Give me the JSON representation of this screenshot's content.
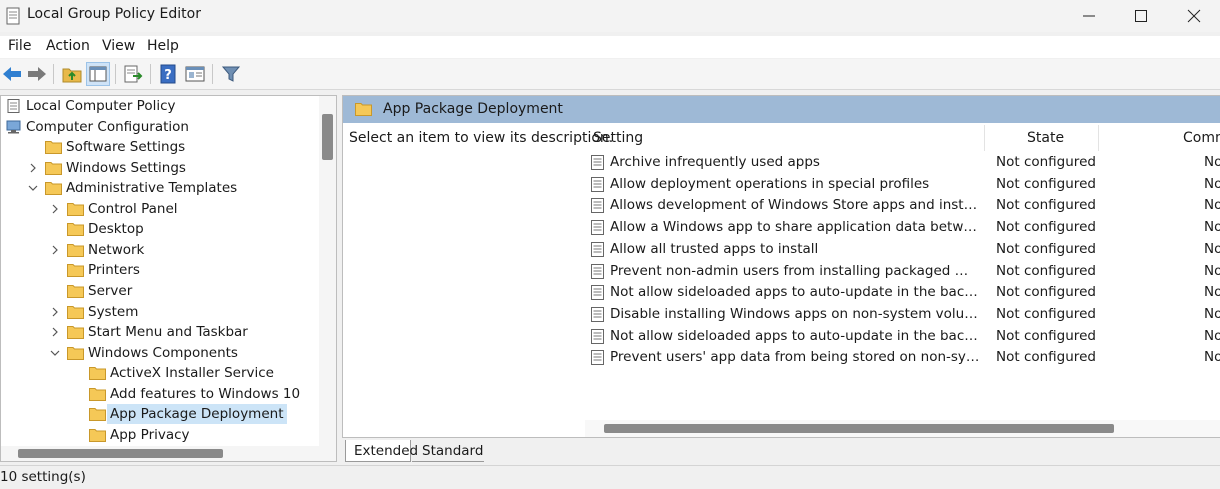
{
  "window": {
    "title": "Local Group Policy Editor",
    "controls": [
      "minimize",
      "maximize",
      "close"
    ]
  },
  "menu": [
    "File",
    "Action",
    "Help",
    "View"
  ],
  "menu_items": {
    "file": "File",
    "action": "Action",
    "view": "View",
    "help": "Help"
  },
  "toolbar": {
    "buttons": [
      "back-icon",
      "forward-icon",
      "up-folder-icon",
      "show-hide-tree-icon",
      "export-list-icon",
      "help-icon",
      "properties-icon",
      "filter-icon"
    ]
  },
  "tree": {
    "items": [
      {
        "label": "Local Computer Policy",
        "level": 0,
        "icon": "policy-document-icon",
        "chevron": "none"
      },
      {
        "label": "Computer Configuration",
        "level": 0,
        "icon": "computer-icon",
        "chevron": "expanded"
      },
      {
        "label": "Software Settings",
        "level": 1,
        "icon": "folder-icon",
        "chevron": "none"
      },
      {
        "label": "Windows Settings",
        "level": 1,
        "icon": "folder-icon",
        "chevron": "collapsed"
      },
      {
        "label": "Administrative Templates",
        "level": 1,
        "icon": "folder-icon",
        "chevron": "expanded"
      },
      {
        "label": "Control Panel",
        "level": 2,
        "icon": "folder-icon",
        "chevron": "collapsed"
      },
      {
        "label": "Desktop",
        "level": 2,
        "icon": "folder-icon",
        "chevron": "none"
      },
      {
        "label": "Network",
        "level": 2,
        "icon": "folder-icon",
        "chevron": "collapsed"
      },
      {
        "label": "Printers",
        "level": 2,
        "icon": "folder-icon",
        "chevron": "none"
      },
      {
        "label": "Server",
        "level": 2,
        "icon": "folder-icon",
        "chevron": "none"
      },
      {
        "label": "System",
        "level": 2,
        "icon": "folder-icon",
        "chevron": "collapsed"
      },
      {
        "label": "Start Menu and Taskbar",
        "level": 2,
        "icon": "folder-icon",
        "chevron": "collapsed"
      },
      {
        "label": "Windows Components",
        "level": 2,
        "icon": "folder-icon",
        "chevron": "expanded"
      },
      {
        "label": "ActiveX Installer Service",
        "level": 3,
        "icon": "folder-icon",
        "chevron": "none"
      },
      {
        "label": "Add features to Windows 10",
        "level": 3,
        "icon": "folder-icon",
        "chevron": "none"
      },
      {
        "label": "App Package Deployment",
        "level": 3,
        "icon": "folder-icon",
        "chevron": "none",
        "selected": true
      },
      {
        "label": "App Privacy",
        "level": 3,
        "icon": "folder-icon",
        "chevron": "none"
      }
    ]
  },
  "details": {
    "header_title": "App Package Deployment",
    "description_prompt": "Select an item to view its description.",
    "columns": {
      "setting": "Setting",
      "state": "State",
      "comment": "Comm"
    },
    "settings": [
      {
        "name": "Archive infrequently used apps",
        "state": "Not configured",
        "comment": "No"
      },
      {
        "name": "Allow deployment operations in special profiles",
        "state": "Not configured",
        "comment": "No"
      },
      {
        "name": "Allows development of Windows Store apps and installing th...",
        "state": "Not configured",
        "comment": "No"
      },
      {
        "name": "Allow a Windows app to share application data between users",
        "state": "Not configured",
        "comment": "No"
      },
      {
        "name": "Allow all trusted apps to install",
        "state": "Not configured",
        "comment": "No"
      },
      {
        "name": "Prevent non-admin users from installing packaged Windows ...",
        "state": "Not configured",
        "comment": "No"
      },
      {
        "name": "Not allow sideloaded apps to auto-update in the background",
        "state": "Not configured",
        "comment": "No"
      },
      {
        "name": "Disable installing Windows apps on non-system volumes",
        "state": "Not configured",
        "comment": "No"
      },
      {
        "name": "Not allow sideloaded apps to auto-update in the backgroun...",
        "state": "Not configured",
        "comment": "No"
      },
      {
        "name": "Prevent users' app data from being stored on non-system vo...",
        "state": "Not configured",
        "comment": "No"
      }
    ]
  },
  "tabs": {
    "extended": "Extended",
    "standard": "Standard"
  },
  "status": {
    "text": "10 setting(s)"
  },
  "colors": {
    "header_band": "#9eb9d6",
    "selection": "#cce4f7",
    "folder": "#f5c857"
  }
}
